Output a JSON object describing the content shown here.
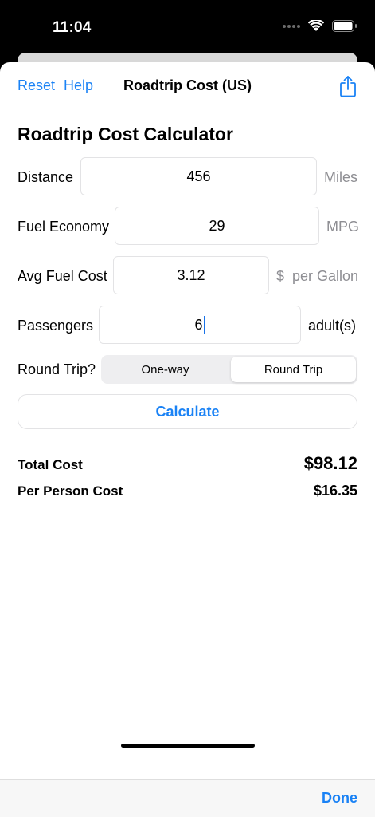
{
  "status_bar": {
    "time": "11:04"
  },
  "nav": {
    "reset_label": "Reset",
    "help_label": "Help",
    "title": "Roadtrip Cost (US)",
    "share_icon": "share-icon"
  },
  "form": {
    "heading": "Roadtrip Cost Calculator",
    "distance": {
      "label": "Distance",
      "value": "456",
      "unit": "Miles"
    },
    "fuel_economy": {
      "label": "Fuel Economy",
      "value": "29",
      "unit": "MPG"
    },
    "avg_fuel_cost": {
      "label": "Avg Fuel Cost",
      "value": "3.12",
      "unit": "$  per Gallon"
    },
    "passengers": {
      "label": "Passengers",
      "value": "6",
      "unit": "adult(s)"
    },
    "round_trip": {
      "label": "Round Trip?",
      "options": [
        "One-way",
        "Round Trip"
      ],
      "selected": "Round Trip"
    },
    "calculate_label": "Calculate"
  },
  "results": {
    "total_cost_label": "Total Cost",
    "total_cost_value": "$98.12",
    "per_person_label": "Per Person Cost",
    "per_person_value": "$16.35"
  },
  "toolbar": {
    "done_label": "Done"
  },
  "colors": {
    "accent": "#1a82f5",
    "unit_gray": "#8e8e93",
    "field_border": "#e3e3e5"
  }
}
